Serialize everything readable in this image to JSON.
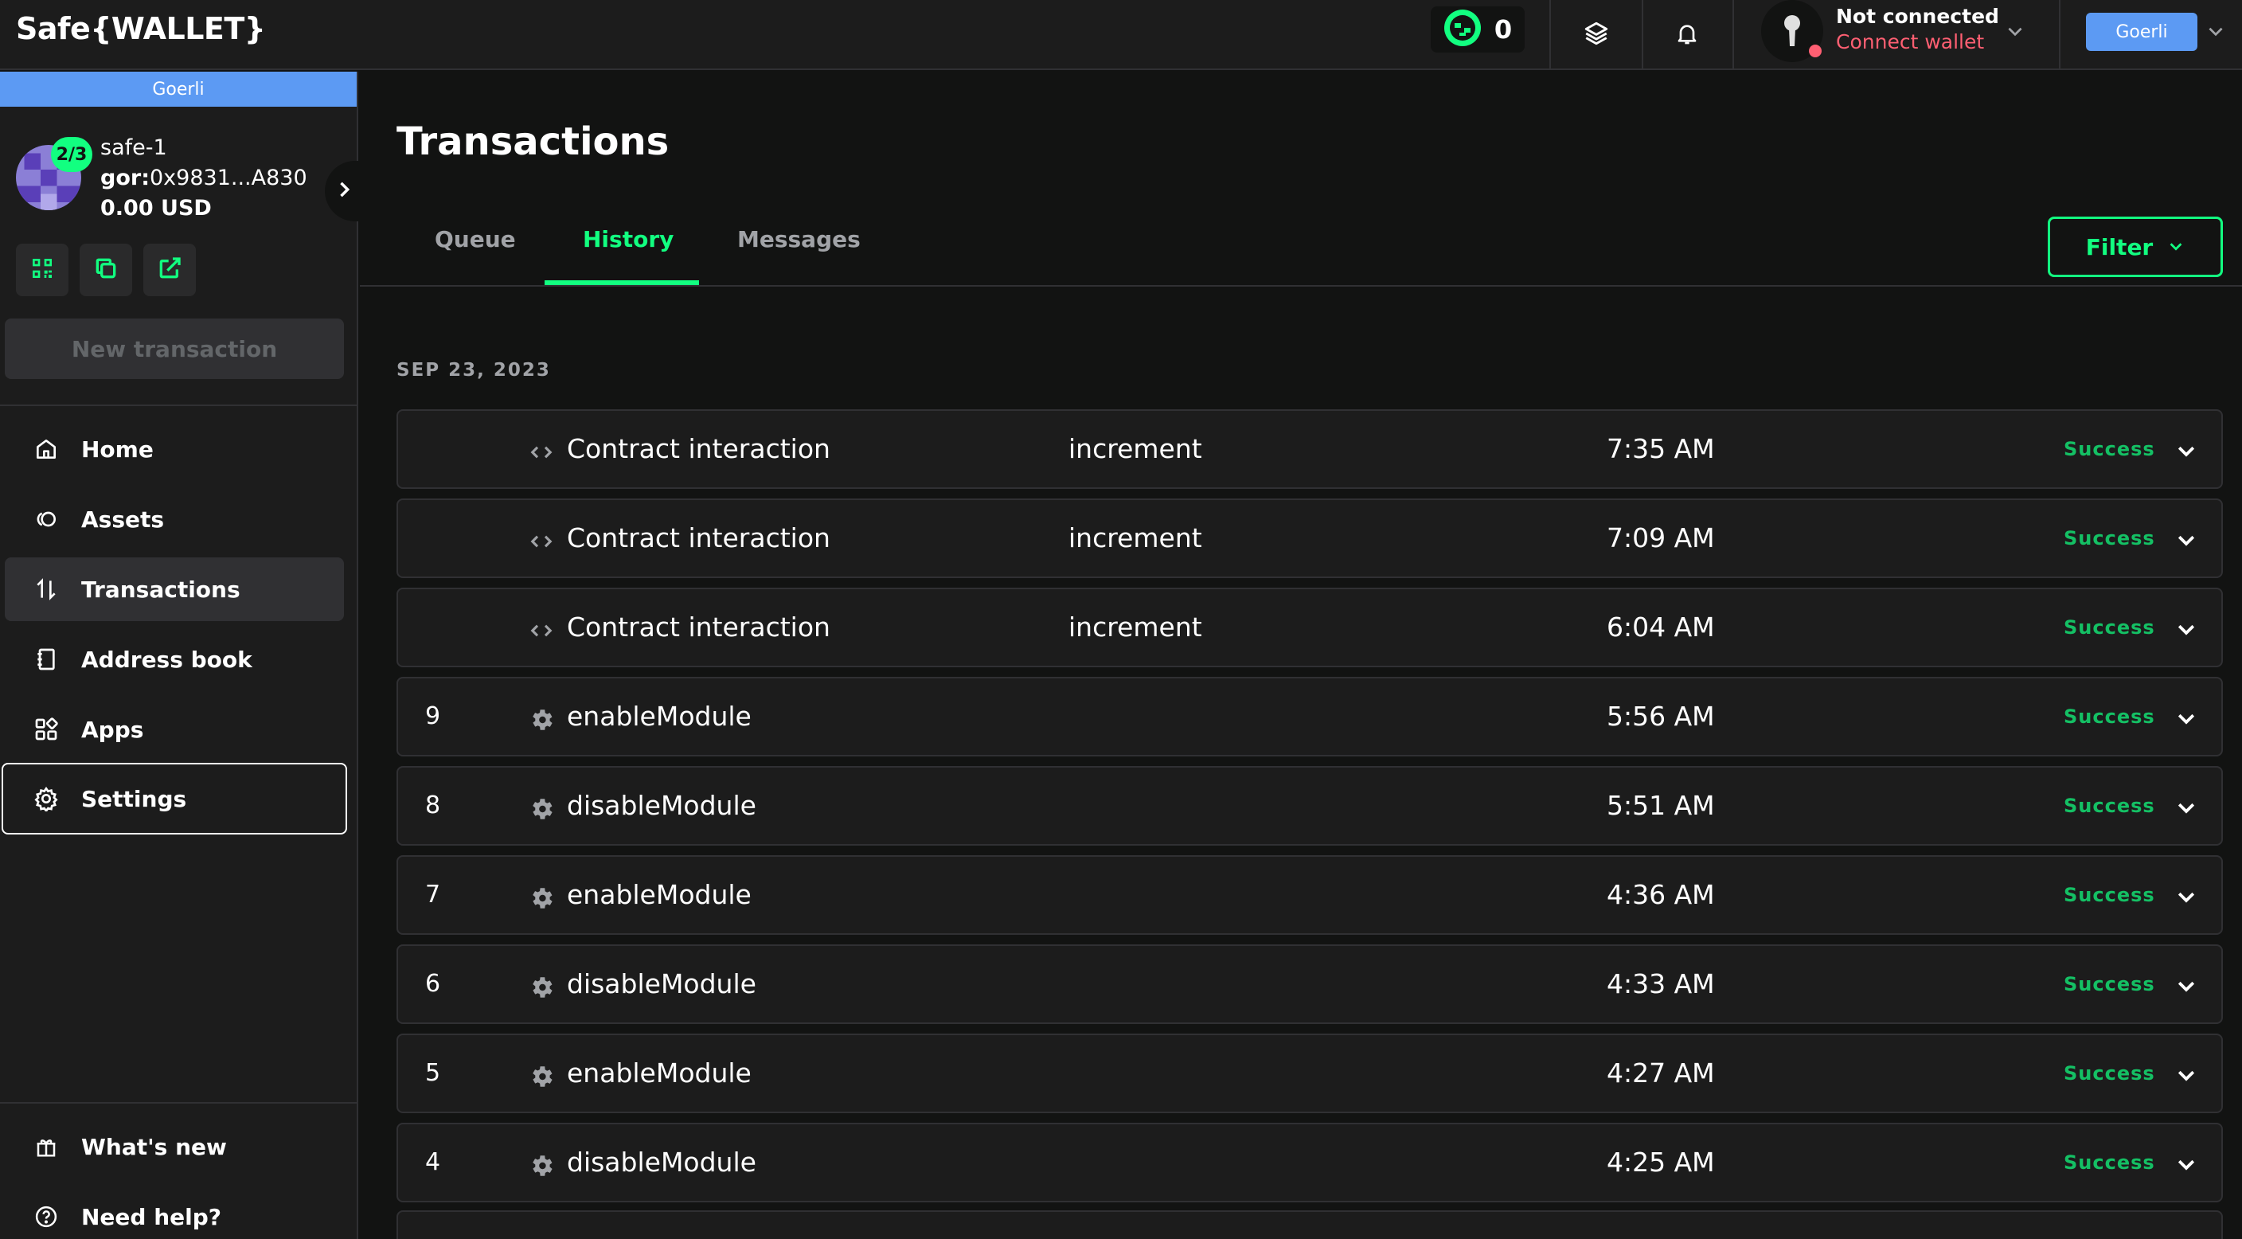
{
  "header": {
    "logo": "Safe{WALLET}",
    "pending_count": "0",
    "connection_status": "Not connected",
    "connect_label": "Connect wallet",
    "network_label": "Goerli"
  },
  "sidebar": {
    "network_banner": "Goerli",
    "safe": {
      "threshold": "2/3",
      "name": "safe-1",
      "chain_prefix": "gor:",
      "address": "0x9831...A830",
      "balance": "0.00 USD"
    },
    "new_transaction_label": "New transaction",
    "nav": [
      {
        "label": "Home",
        "icon": "home-icon"
      },
      {
        "label": "Assets",
        "icon": "assets-icon"
      },
      {
        "label": "Transactions",
        "icon": "transactions-icon"
      },
      {
        "label": "Address book",
        "icon": "address-book-icon"
      },
      {
        "label": "Apps",
        "icon": "apps-icon"
      },
      {
        "label": "Settings",
        "icon": "settings-icon"
      }
    ],
    "footer": [
      {
        "label": "What's new",
        "icon": "gift-icon"
      },
      {
        "label": "Need help?",
        "icon": "help-icon"
      }
    ]
  },
  "main": {
    "title": "Transactions",
    "tabs": [
      {
        "label": "Queue"
      },
      {
        "label": "History"
      },
      {
        "label": "Messages"
      }
    ],
    "active_tab": "History",
    "filter_label": "Filter",
    "date_group": "SEP 23, 2023",
    "transactions": [
      {
        "nonce": "",
        "type": "Contract interaction",
        "method": "increment",
        "time": "7:35 AM",
        "status": "Success",
        "icon": "code-icon"
      },
      {
        "nonce": "",
        "type": "Contract interaction",
        "method": "increment",
        "time": "7:09 AM",
        "status": "Success",
        "icon": "code-icon"
      },
      {
        "nonce": "",
        "type": "Contract interaction",
        "method": "increment",
        "time": "6:04 AM",
        "status": "Success",
        "icon": "code-icon"
      },
      {
        "nonce": "9",
        "type": "enableModule",
        "method": "",
        "time": "5:56 AM",
        "status": "Success",
        "icon": "settings-gear-icon"
      },
      {
        "nonce": "8",
        "type": "disableModule",
        "method": "",
        "time": "5:51 AM",
        "status": "Success",
        "icon": "settings-gear-icon"
      },
      {
        "nonce": "7",
        "type": "enableModule",
        "method": "",
        "time": "4:36 AM",
        "status": "Success",
        "icon": "settings-gear-icon"
      },
      {
        "nonce": "6",
        "type": "disableModule",
        "method": "",
        "time": "4:33 AM",
        "status": "Success",
        "icon": "settings-gear-icon"
      },
      {
        "nonce": "5",
        "type": "enableModule",
        "method": "",
        "time": "4:27 AM",
        "status": "Success",
        "icon": "settings-gear-icon"
      },
      {
        "nonce": "4",
        "type": "disableModule",
        "method": "",
        "time": "4:25 AM",
        "status": "Success",
        "icon": "settings-gear-icon"
      }
    ]
  },
  "colors": {
    "accent": "#12ff80",
    "network": "#5c9af3",
    "error": "#ff5f72",
    "background": "#121312",
    "surface": "#1c1c1c"
  }
}
